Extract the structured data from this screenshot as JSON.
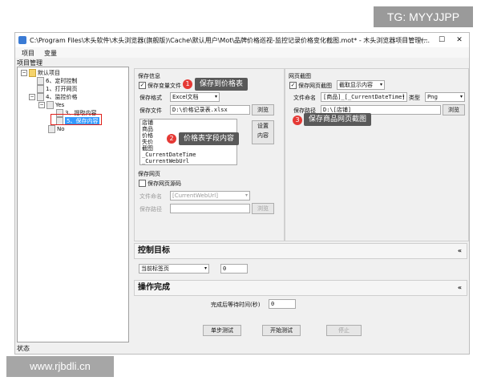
{
  "watermark_top": "TG: MYYJJPP",
  "watermark_bottom": "www.rjbdli.cn",
  "window": {
    "title": "C:\\Program Files\\木头软件\\木头浏览器(旗舰版)\\Cache\\默认用户\\Mot\\品牌价格巡视-监控记录价格变化截图.mot* - 木头浏览器项目管理(...",
    "minimize": "—",
    "maximize": "☐",
    "close": "✕"
  },
  "menu": {
    "project": "项目",
    "variable": "变量"
  },
  "project_panel_label": "项目管理",
  "tree": {
    "root": "默认项目",
    "items": [
      "6、定时控制",
      "1、打开网页",
      "4、监控价格",
      "Yes",
      "3、提取内容",
      "5、保存内容",
      "No"
    ],
    "expander_minus": "−"
  },
  "save_info": {
    "title": "保存信息",
    "save_var_label": "保存变量文件",
    "checked_mark": "✓",
    "format_label": "保存格式",
    "format_value": "Excel文档",
    "file_label": "保存文件",
    "file_value": "D:\\价格记录表.xlsx",
    "browse": "浏览",
    "fields": [
      "店铺",
      "商品",
      "价格",
      "失价",
      "截图",
      "_CurrentDateTime",
      "_CurrentWebUrl"
    ],
    "set_content_btn_line1": "设置",
    "set_content_btn_line2": "内容"
  },
  "save_webpage": {
    "title": "保存网页",
    "save_source_label": "保存网页源码",
    "file_name_label": "文件命名",
    "file_name_value": "[CurrentWebUrl]",
    "path_label": "保存路径",
    "browse": "浏览"
  },
  "screenshot": {
    "title": "网页截图",
    "save_shot_label": "保存网页截图",
    "mode_value": "截取显示内容",
    "name_label": "文件命名",
    "name_value": "[商品]_[_CurrentDateTime]",
    "type_label": "类型",
    "type_value": "Png",
    "path_label": "保存路径",
    "path_value": "D:\\[店铺]",
    "browse": "浏览"
  },
  "callouts": [
    {
      "num": "1",
      "text": "保存到价格表"
    },
    {
      "num": "2",
      "text": "价格表字段内容"
    },
    {
      "num": "3",
      "text": "保存商品网页截图"
    }
  ],
  "control_target": {
    "title": "控制目标",
    "chevron": "«",
    "select_value": "当前标签页",
    "spin_value": "0"
  },
  "finish": {
    "title": "操作完成",
    "chevron": "«",
    "wait_label": "完成后等待时间(秒)",
    "wait_value": "0"
  },
  "buttons": {
    "step_test": "单步测试",
    "start_test": "开始测试",
    "stop": "停止"
  },
  "status_text": "状态",
  "colors": {
    "accent_red": "#e53935",
    "callout_bg": "#595959",
    "selection": "#3399ff"
  }
}
